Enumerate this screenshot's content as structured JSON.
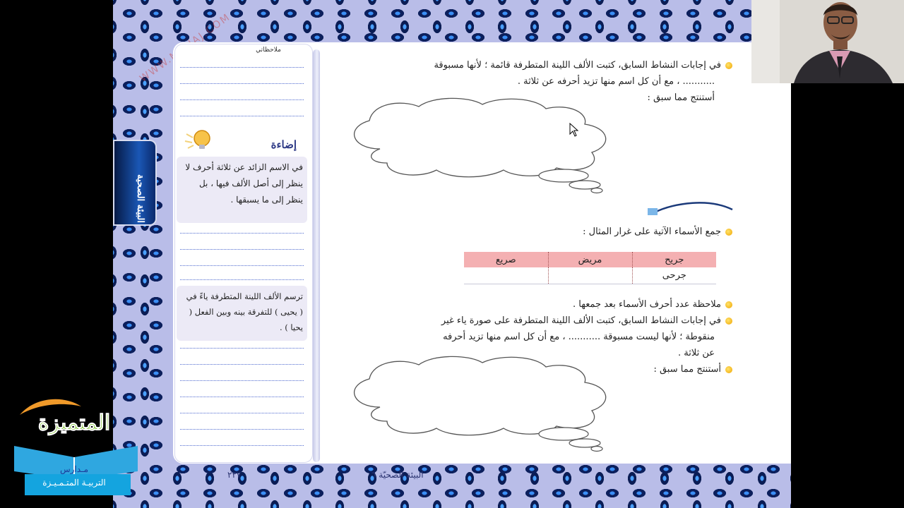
{
  "sidebar": {
    "notes_header": "ملاحظاتي",
    "tab_label": "البيئة الصحية",
    "idea_title": "إضاءة",
    "idea_text": "في الاسم الزائد عن ثلاثة أحرف لا ينظر إلى أصل الألف فيها ، بل ينظر إلى ما يسبقها .",
    "tip_text": "ترسم الألف اللينة المتطرفة ياءً في ( يحيى ) للتفرقة بينه وبين الفعل ( يحيا ) ."
  },
  "content": {
    "line1": "في إجابات النشاط السابق، كتبت الألف اللينة المتطرفة قائمة ؛ لأنها مسبوقة",
    "line2": "........... ، مع أن كل اسم منها تزيد أحرفه عن ثلاثة .",
    "line3": "أستنتج مما سبق :",
    "line4": "جمع الأسماء الآتية على غرار المثال :",
    "line5": "ملاحظة عدد أحرف الأسماء بعد جمعها .",
    "line6": "في إجابات النشاط السابق، كتبت الألف اللينة المتطرفة على صورة ياء غير",
    "line7": "منقوطة ؛ لأنها ليست مسبوقة ........... ، مع أن كل اسم منها تزيد أحرفه",
    "line8": "عن ثلاثة .",
    "line9": "أستنتج مما سبق :"
  },
  "table": {
    "headers": [
      "جريح",
      "مريض",
      "صريع"
    ],
    "row": [
      "جرحى",
      "",
      ""
    ]
  },
  "footer": {
    "page_number": "٢٢٧",
    "unit_label": "البيئة الصحيّة ٦"
  },
  "watermark": "WWW.MNHAJ.COM",
  "logo": {
    "name": "المتميزة",
    "sub1": "مـدارس",
    "sub2": "التربيـة المتـمـيـزة"
  },
  "colors": {
    "bullet": "#f0a400",
    "table_header": "#f4b0b2",
    "page_bg": "#b9bde8"
  }
}
